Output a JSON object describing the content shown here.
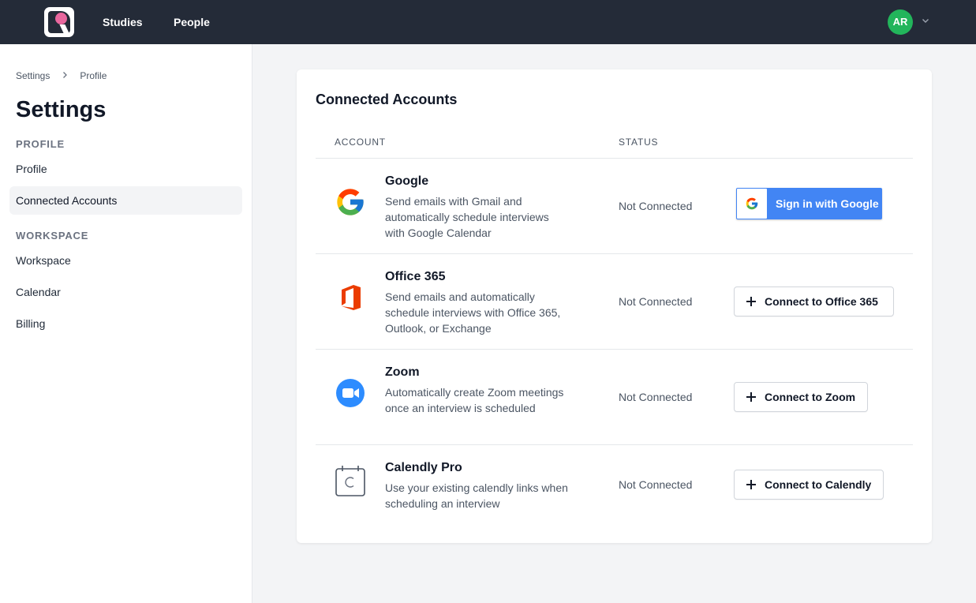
{
  "nav": {
    "logo_label": "R",
    "links": [
      "Studies",
      "People"
    ],
    "avatar_initials": "AR"
  },
  "sidebar": {
    "breadcrumb": [
      "Settings",
      "Profile"
    ],
    "title": "Settings",
    "sections": [
      {
        "heading": "PROFILE",
        "items": [
          "Profile",
          "Connected Accounts"
        ]
      },
      {
        "heading": "WORKSPACE",
        "items": [
          "Workspace",
          "Calendar",
          "Billing"
        ]
      }
    ],
    "active_item": "Connected Accounts"
  },
  "main": {
    "title": "Connected Accounts",
    "columns": [
      "ACCOUNT",
      "STATUS"
    ],
    "accounts": [
      {
        "name": "Google",
        "icon": "google-icon",
        "description": "Send emails with Gmail and automatically schedule interviews with Google Calendar",
        "status": "Not Connected",
        "action": "Sign in with Google"
      },
      {
        "name": "Office 365",
        "icon": "office-365-icon",
        "description": "Send emails and automatically schedule interviews with Office 365, Outlook, or Exchange",
        "status": "Not Connected",
        "action": "Connect to Office 365"
      },
      {
        "name": "Zoom",
        "icon": "zoom-icon",
        "description": "Automatically create Zoom meetings once an interview is scheduled",
        "status": "Not Connected",
        "action": "Connect to Zoom"
      },
      {
        "name": "Calendly Pro",
        "icon": "calendly-icon",
        "description": "Use your existing calendly links when scheduling an interview",
        "status": "Not Connected",
        "action": "Connect to Calendly"
      }
    ]
  },
  "colors": {
    "topbar": "#242b38",
    "accent_pink": "#e9679e",
    "avatar_green": "#22b55b",
    "google_blue": "#4285f4",
    "office_orange": "#eb3c00",
    "zoom_blue": "#2d8cff"
  }
}
